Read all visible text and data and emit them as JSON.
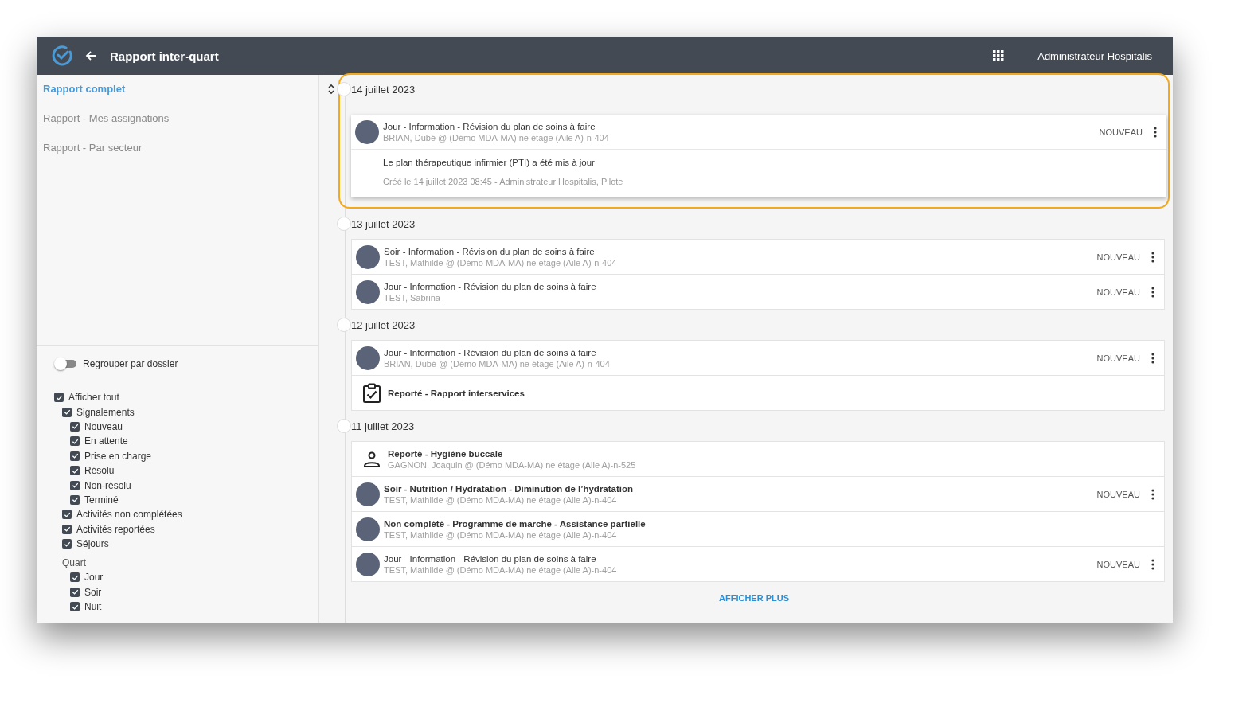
{
  "header": {
    "title": "Rapport inter-quart",
    "user": "Administrateur Hospitalis"
  },
  "sidebar": {
    "reports": [
      {
        "label": "Rapport complet",
        "selected": true
      },
      {
        "label": "Rapport - Mes assignations",
        "selected": false
      },
      {
        "label": "Rapport - Par secteur",
        "selected": false
      }
    ],
    "group_toggle": {
      "label": "Regrouper par dossier",
      "on": false
    },
    "filters": [
      {
        "label": "Afficher tout",
        "checked": true,
        "children": [
          {
            "label": "Signalements",
            "checked": true,
            "children": [
              {
                "label": "Nouveau",
                "checked": true
              },
              {
                "label": "En attente",
                "checked": true
              },
              {
                "label": "Prise en charge",
                "checked": true
              },
              {
                "label": "Résolu",
                "checked": true
              },
              {
                "label": "Non-résolu",
                "checked": true
              },
              {
                "label": "Terminé",
                "checked": true
              }
            ]
          },
          {
            "label": "Activités non complétées",
            "checked": true
          },
          {
            "label": "Activités reportées",
            "checked": true
          },
          {
            "label": "Séjours",
            "checked": true
          }
        ]
      }
    ],
    "quart": {
      "title": "Quart",
      "items": [
        {
          "label": "Jour",
          "checked": true
        },
        {
          "label": "Soir",
          "checked": true
        },
        {
          "label": "Nuit",
          "checked": true
        }
      ]
    }
  },
  "timeline": {
    "days": [
      {
        "date": "14 juillet 2023",
        "highlighted": true,
        "entries": [
          {
            "kind": "photo",
            "bold": false,
            "title": "Jour - Information - Révision du plan de soins à faire",
            "subtitle": "BRIAN, Dubé @ (Démo MDA-MA) ne étage (Aile A)-n-404",
            "status": "NOUVEAU",
            "details": {
              "message": "Le plan thérapeutique infirmier (PTI) a été mis à jour",
              "created": "Créé le 14 juillet 2023 08:45 - Administrateur Hospitalis, Pilote"
            }
          }
        ]
      },
      {
        "date": "13 juillet 2023",
        "highlighted": false,
        "entries": [
          {
            "kind": "photo",
            "bold": false,
            "title": "Soir - Information - Révision du plan de soins à faire",
            "subtitle": "TEST, Mathilde @ (Démo MDA-MA) ne étage (Aile A)-n-404",
            "status": "NOUVEAU"
          },
          {
            "kind": "photo",
            "bold": false,
            "title": "Jour - Information - Révision du plan de soins à faire",
            "subtitle": "TEST, Sabrina",
            "status": "NOUVEAU"
          }
        ]
      },
      {
        "date": "12 juillet 2023",
        "highlighted": false,
        "entries": [
          {
            "kind": "photo",
            "bold": false,
            "title": "Jour - Information - Révision du plan de soins à faire",
            "subtitle": "BRIAN, Dubé @ (Démo MDA-MA) ne étage (Aile A)-n-404",
            "status": "NOUVEAU"
          },
          {
            "kind": "clipboard",
            "bold": true,
            "title": "Reporté - Rapport interservices"
          }
        ]
      },
      {
        "date": "11 juillet 2023",
        "highlighted": false,
        "entries": [
          {
            "kind": "person",
            "bold": true,
            "title": "Reporté - Hygiène buccale",
            "subtitle": "GAGNON, Joaquin @ (Démo MDA-MA) ne étage (Aile A)-n-525"
          },
          {
            "kind": "photo",
            "bold": true,
            "title": "Soir - Nutrition / Hydratation - Diminution de l’hydratation",
            "subtitle": "TEST, Mathilde @ (Démo MDA-MA) ne étage (Aile A)-n-404",
            "status": "NOUVEAU"
          },
          {
            "kind": "photo",
            "bold": true,
            "title": "Non complété - Programme de marche - Assistance partielle",
            "subtitle": "TEST, Mathilde @ (Démo MDA-MA) ne étage (Aile A)-n-404"
          },
          {
            "kind": "photo",
            "bold": false,
            "title": "Jour - Information - Révision du plan de soins à faire",
            "subtitle": "TEST, Mathilde @ (Démo MDA-MA) ne étage (Aile A)-n-404",
            "status": "NOUVEAU"
          }
        ]
      }
    ],
    "show_more": "AFFICHER PLUS"
  }
}
